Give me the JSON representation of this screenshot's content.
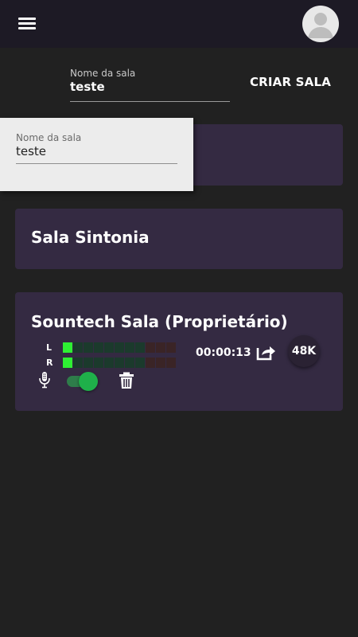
{
  "header": {
    "menu_icon": "hamburger-menu-icon",
    "avatar_icon": "user-avatar-icon"
  },
  "create_room": {
    "label": "Nome da sala",
    "value": "teste",
    "button_label": "CRIAR SALA"
  },
  "autocomplete_popup": {
    "label": "Nome da sala",
    "value": "teste"
  },
  "rooms": [
    {
      "name": ""
    },
    {
      "name": "Sala Sintonia"
    },
    {
      "name": "Sountech Sala (Proprietário)",
      "meter": {
        "left_label": "L",
        "right_label": "R",
        "segments_total": 11,
        "left_active": 1,
        "right_active": 1
      },
      "timer": "00:00:13",
      "bitrate": "48K",
      "mic_enabled": true
    }
  ],
  "colors": {
    "background": "#212121",
    "topbar": "#1d1a25",
    "card": "#342a42",
    "meter_active": "#2ef033",
    "toggle_on": "#1fb04a"
  }
}
